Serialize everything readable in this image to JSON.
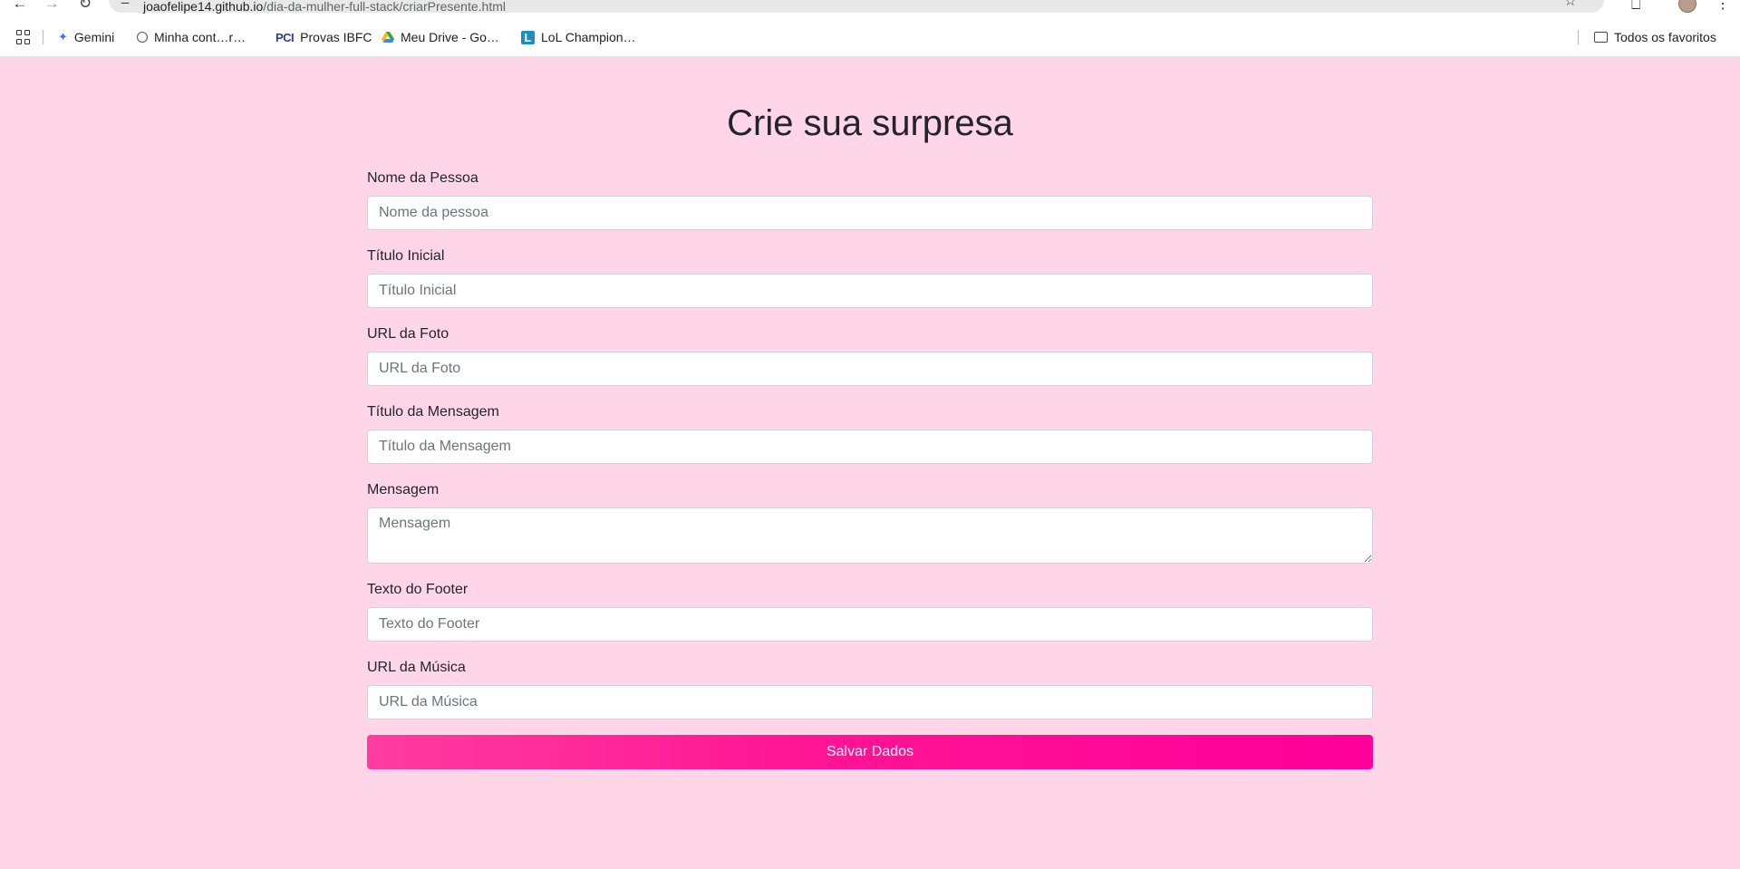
{
  "browser": {
    "url_host": "joaofelipe14.github.io",
    "url_path": "/dia-da-mulher-full-stack/criarPresente.html"
  },
  "bookmarks": {
    "items": [
      {
        "label": "Gemini",
        "icon": "gemini-icon"
      },
      {
        "label": "Minha cont…r…",
        "icon": "account-icon"
      },
      {
        "label": "Provas IBFC",
        "icon": "pci-icon"
      },
      {
        "label": "Meu Drive - Go…",
        "icon": "drive-icon"
      },
      {
        "label": "LoL Champion…",
        "icon": "lol-icon"
      }
    ],
    "all_bookmarks": "Todos os favoritos"
  },
  "page": {
    "title": "Crie sua surpresa",
    "background_color": "#ffd6e7",
    "fields": [
      {
        "label": "Nome da Pessoa",
        "placeholder": "Nome da pessoa",
        "value": ""
      },
      {
        "label": "Título Inicial",
        "placeholder": "Título Inicial",
        "value": ""
      },
      {
        "label": "URL da Foto",
        "placeholder": "URL da Foto",
        "value": ""
      },
      {
        "label": "Título da Mensagem",
        "placeholder": "Título da Mensagem",
        "value": ""
      },
      {
        "label": "Mensagem",
        "placeholder": "Mensagem",
        "value": ""
      },
      {
        "label": "Texto do Footer",
        "placeholder": "Texto do Footer",
        "value": ""
      },
      {
        "label": "URL da Música",
        "placeholder": "URL da Música",
        "value": ""
      }
    ],
    "submit_label": "Salvar Dados",
    "submit_color": "#ff1493"
  }
}
